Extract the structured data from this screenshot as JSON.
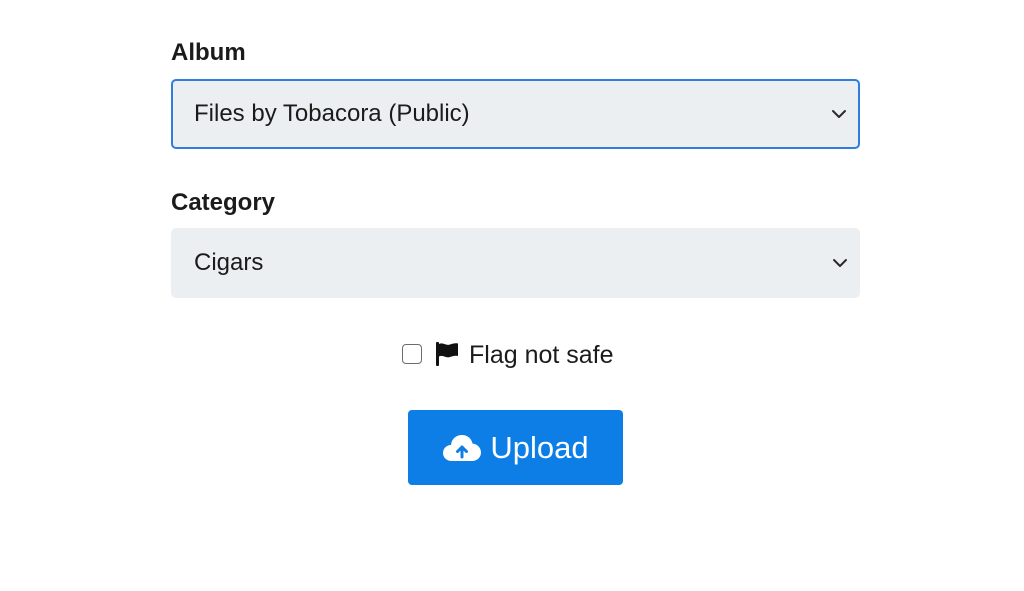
{
  "album": {
    "label": "Album",
    "selected": "Files by Tobacora (Public)"
  },
  "category": {
    "label": "Category",
    "selected": "Cigars"
  },
  "nsfw": {
    "checked": false,
    "label": "Flag not safe",
    "icon": "flag-icon"
  },
  "upload": {
    "label": "Upload",
    "icon": "cloud-upload-icon",
    "color": "#0d7ee6"
  },
  "colors": {
    "focus_border": "#2f7de1",
    "field_background": "#eceff1"
  }
}
